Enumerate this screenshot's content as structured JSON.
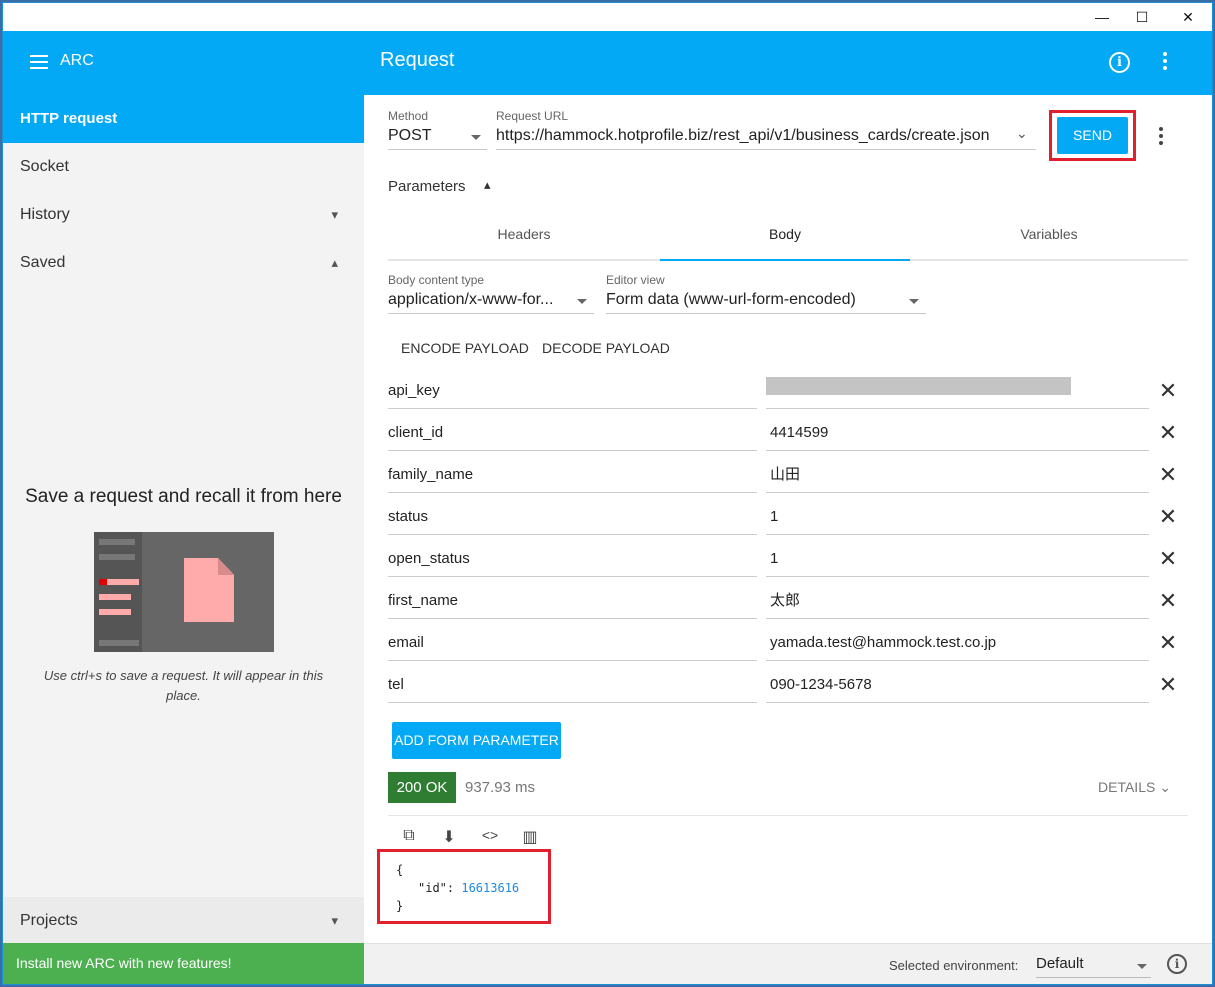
{
  "window": {
    "minimize": "—",
    "maximize": "☐",
    "close": "✕"
  },
  "appbar": {
    "brand": "ARC",
    "title": "Request",
    "info_icon": "i"
  },
  "sidebar": {
    "items": [
      {
        "label": "HTTP request",
        "active": true
      },
      {
        "label": "Socket"
      },
      {
        "label": "History",
        "chevron": "▾"
      },
      {
        "label": "Saved",
        "chevron": "▴"
      }
    ],
    "empty_title": "Save a request and recall it from here",
    "empty_hint": "Use ctrl+s to save a request. It will appear in this place.",
    "projects": "Projects",
    "projects_chevron": "▾",
    "install": "Install new ARC with new features!"
  },
  "request": {
    "method_label": "Method",
    "method": "POST",
    "url_label": "Request URL",
    "url": "https://hammock.hotprofile.biz/rest_api/v1/business_cards/create.json",
    "send": "SEND",
    "parameters": "Parameters",
    "parameters_chevron": "▴"
  },
  "tabs": [
    "Headers",
    "Body",
    "Variables"
  ],
  "body": {
    "content_type_label": "Body content type",
    "content_type": "application/x-www-for...",
    "editor_view_label": "Editor view",
    "editor_view": "Form data (www-url-form-encoded)",
    "encode": "ENCODE PAYLOAD",
    "decode": "DECODE PAYLOAD"
  },
  "form_params": [
    {
      "key": "api_key",
      "value": ""
    },
    {
      "key": "client_id",
      "value": "4414599"
    },
    {
      "key": "family_name",
      "value": "山田"
    },
    {
      "key": "status",
      "value": "1"
    },
    {
      "key": "open_status",
      "value": "1"
    },
    {
      "key": "first_name",
      "value": "太郎"
    },
    {
      "key": "email",
      "value": "yamada.test@hammock.test.co.jp"
    },
    {
      "key": "tel",
      "value": "090-1234-5678"
    }
  ],
  "delete_glyph": "✕",
  "add_form_parameter": "ADD FORM PARAMETER",
  "response": {
    "status": "200 OK",
    "time": "937.93 ms",
    "details": "DETAILS ⌄",
    "tools": {
      "copy": "⧉",
      "save": "⬇",
      "code": "<>",
      "columns": "▥"
    },
    "open_brace": "{",
    "json_key": "\"id\": ",
    "json_value": "16613616",
    "close_brace": "}"
  },
  "footer": {
    "env_label": "Selected environment:",
    "env_value": "Default"
  },
  "colors": {
    "accent": "#03a9f4",
    "success": "#2e7d32",
    "install_bg": "#4caf50",
    "highlight": "#e0202e"
  }
}
